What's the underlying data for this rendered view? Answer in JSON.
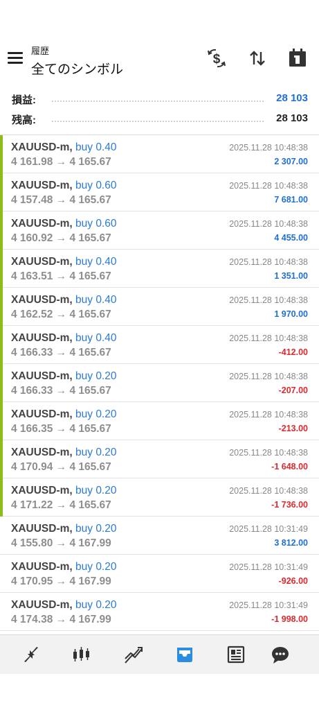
{
  "header": {
    "subtitle": "履歴",
    "title": "全てのシンボル",
    "icons": [
      "hamburger-icon",
      "dollar-exchange-icon",
      "sort-icon",
      "calendar-icon"
    ]
  },
  "summary": {
    "profit_label": "損益:",
    "profit_value": "28 103",
    "balance_label": "残高:",
    "balance_value": "28 103"
  },
  "colors": {
    "positive": "#1f6fd6",
    "negative": "#e0282e",
    "open_bar": "#8cbd1b",
    "side": "#2b7bd6"
  },
  "trades": [
    {
      "symbol": "XAUUSD-m,",
      "side": "buy 0.40",
      "price": "4 161.98 → 4 165.67",
      "time": "2025.11.28 10:48:38",
      "profit": "2 307.00",
      "positive": true,
      "bar": true
    },
    {
      "symbol": "XAUUSD-m,",
      "side": "buy 0.60",
      "price": "4 157.48 → 4 165.67",
      "time": "2025.11.28 10:48:38",
      "profit": "7 681.00",
      "positive": true,
      "bar": true
    },
    {
      "symbol": "XAUUSD-m,",
      "side": "buy 0.60",
      "price": "4 160.92 → 4 165.67",
      "time": "2025.11.28 10:48:38",
      "profit": "4 455.00",
      "positive": true,
      "bar": true
    },
    {
      "symbol": "XAUUSD-m,",
      "side": "buy 0.40",
      "price": "4 163.51 → 4 165.67",
      "time": "2025.11.28 10:48:38",
      "profit": "1 351.00",
      "positive": true,
      "bar": true
    },
    {
      "symbol": "XAUUSD-m,",
      "side": "buy 0.40",
      "price": "4 162.52 → 4 165.67",
      "time": "2025.11.28 10:48:38",
      "profit": "1 970.00",
      "positive": true,
      "bar": true
    },
    {
      "symbol": "XAUUSD-m,",
      "side": "buy 0.40",
      "price": "4 166.33 → 4 165.67",
      "time": "2025.11.28 10:48:38",
      "profit": "-412.00",
      "positive": false,
      "bar": true
    },
    {
      "symbol": "XAUUSD-m,",
      "side": "buy 0.20",
      "price": "4 166.33 → 4 165.67",
      "time": "2025.11.28 10:48:38",
      "profit": "-207.00",
      "positive": false,
      "bar": true
    },
    {
      "symbol": "XAUUSD-m,",
      "side": "buy 0.20",
      "price": "4 166.35 → 4 165.67",
      "time": "2025.11.28 10:48:38",
      "profit": "-213.00",
      "positive": false,
      "bar": true
    },
    {
      "symbol": "XAUUSD-m,",
      "side": "buy 0.20",
      "price": "4 170.94 → 4 165.67",
      "time": "2025.11.28 10:48:38",
      "profit": "-1 648.00",
      "positive": false,
      "bar": true
    },
    {
      "symbol": "XAUUSD-m,",
      "side": "buy 0.20",
      "price": "4 171.22 → 4 165.67",
      "time": "2025.11.28 10:48:38",
      "profit": "-1 736.00",
      "positive": false,
      "bar": true
    },
    {
      "symbol": "XAUUSD-m,",
      "side": "buy 0.20",
      "price": "4 155.80 → 4 167.99",
      "time": "2025.11.28 10:31:49",
      "profit": "3 812.00",
      "positive": true,
      "bar": false
    },
    {
      "symbol": "XAUUSD-m,",
      "side": "buy 0.20",
      "price": "4 170.95 → 4 167.99",
      "time": "2025.11.28 10:31:49",
      "profit": "-926.00",
      "positive": false,
      "bar": false
    },
    {
      "symbol": "XAUUSD-m,",
      "side": "buy 0.20",
      "price": "4 174.38 → 4 167.99",
      "time": "2025.11.28 10:31:49",
      "profit": "-1 998.00",
      "positive": false,
      "bar": false
    }
  ],
  "tabs": [
    {
      "name": "quotes-icon",
      "active": false
    },
    {
      "name": "chart-icon",
      "active": false
    },
    {
      "name": "trade-icon",
      "active": false
    },
    {
      "name": "history-icon",
      "active": true
    },
    {
      "name": "news-icon",
      "active": false
    },
    {
      "name": "messages-icon",
      "active": false
    }
  ]
}
